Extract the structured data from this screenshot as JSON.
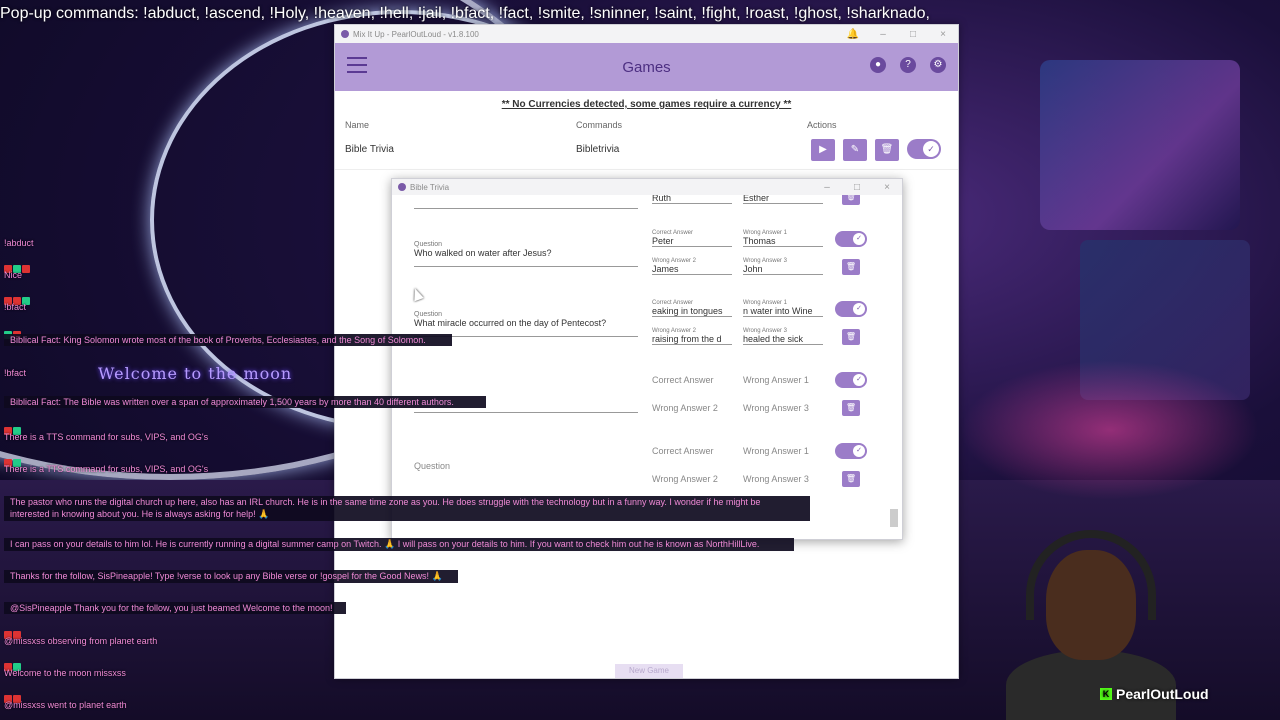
{
  "ticker": "Pop-up commands: !abduct, !ascend, !Holy, !heaven, !hell,  !jail, !bfact, !fact, !smite, !sninner, !saint, !fight, !roast, !ghost, !sharknado,",
  "app": {
    "window_title": "Mix It Up - PearlOutLoud - v1.8.100",
    "page_title": "Games",
    "warning": "** No Currencies detected, some games require a currency **",
    "columns": {
      "name": "Name",
      "commands": "Commands",
      "actions": "Actions"
    },
    "game": {
      "name": "Bible Trivia",
      "command": "Bibletrivia"
    },
    "new_game": "New Game"
  },
  "popup": {
    "title": "Bible Trivia",
    "top_partial": {
      "correct": "Ruth",
      "wrong1": "Esther"
    },
    "labels": {
      "question": "Question",
      "correct": "Correct Answer",
      "wrong1": "Wrong Answer 1",
      "wrong2": "Wrong Answer 2",
      "wrong3": "Wrong Answer 3"
    },
    "questions": [
      {
        "text": "Who walked on water after Jesus?",
        "correct": "Peter",
        "wrong1": "Thomas",
        "wrong2": "James",
        "wrong3": "John"
      },
      {
        "text": "What miracle occurred on the day of Pentecost?",
        "correct": "eaking in tongues",
        "wrong1": "n water into Wine",
        "wrong2": "raising from the d",
        "wrong3": "healed the sick"
      }
    ],
    "empty_placeholder": "Question"
  },
  "chat": {
    "command": "!abduct",
    "lines": [
      "Nice",
      "!bfact",
      "!bfact",
      "Biblical Fact: King Solomon wrote most of the book of Proverbs, Ecclesiastes, and the Song of Solomon.",
      "Biblical Fact: The Bible was written over a span of approximately 1,500 years by more than 40 different authors.",
      "There is a TTS command for subs, VIPS, and OG's",
      "There is a TTS command for subs, VIPS, and OG's",
      "The pastor who runs the digital church up here, also has an IRL church. He is in the same time zone as you. He does struggle with the technology but in a funny way. I wonder if he might be",
      "interested in knowing about you. He is always asking for help! 🙏",
      "I can pass on your details to him lol. He is currently running a digital summer camp on Twitch. 🙏 I will pass on your details to him. If you want to check him out he is known as NorthHillLive.",
      "Thanks for the follow, SisPineapple! Type !verse to look up any Bible verse or !gospel for the Good News! 🙏",
      "@SisPineapple Thank you for the follow, you just beamed Welcome to the moon!",
      "@missxss observing from planet earth",
      "Welcome to the moon missxss",
      "@missxss went to planet earth"
    ],
    "welcome_sign": "Welcome to the moon"
  },
  "cam": {
    "name": "PearlOutLoud"
  }
}
